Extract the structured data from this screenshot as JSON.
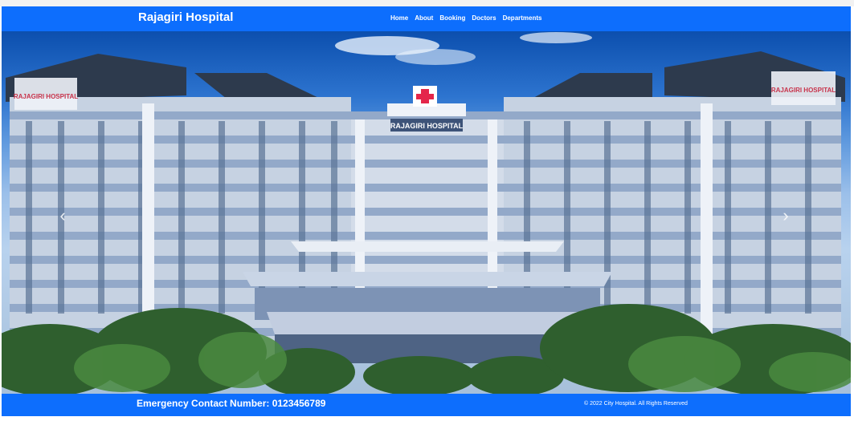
{
  "navbar": {
    "brand": "Rajagiri Hospital",
    "links": [
      "Home",
      "About",
      "Booking",
      "Doctors",
      "Departments"
    ]
  },
  "hero": {
    "image_sign_main": "RAJAGIRI HOSPITAL",
    "image_sign_left": "RAJAGIRI HOSPITAL",
    "image_sign_right": "RAJAGIRI HOSPITAL",
    "prev_icon": "chevron-left-icon",
    "next_icon": "chevron-right-icon"
  },
  "footer": {
    "emergency": "Emergency Contact Number: 0123456789",
    "copyright": "© 2022 City Hospital. All Rights Reserved"
  },
  "colors": {
    "primary": "#0d6efd",
    "text_light": "#ffffff"
  }
}
